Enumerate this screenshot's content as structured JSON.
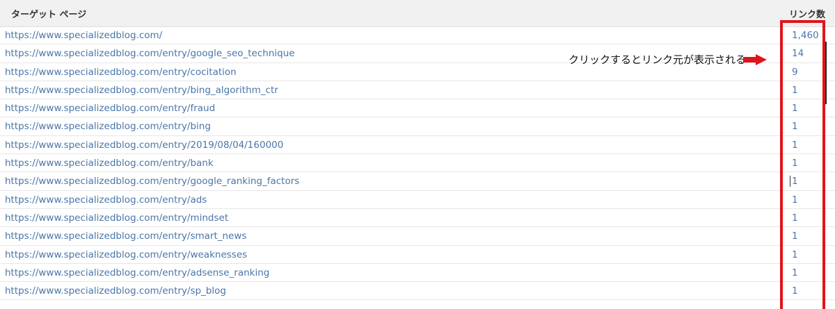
{
  "table": {
    "header": {
      "target_page": "ターゲット ページ",
      "link_count": "リンク数"
    },
    "rows": [
      {
        "url": "https://www.specializedblog.com/",
        "count": "1,460"
      },
      {
        "url": "https://www.specializedblog.com/entry/google_seo_technique",
        "count": "14"
      },
      {
        "url": "https://www.specializedblog.com/entry/cocitation",
        "count": "9"
      },
      {
        "url": "https://www.specializedblog.com/entry/bing_algorithm_ctr",
        "count": "1"
      },
      {
        "url": "https://www.specializedblog.com/entry/fraud",
        "count": "1"
      },
      {
        "url": "https://www.specializedblog.com/entry/bing",
        "count": "1"
      },
      {
        "url": "https://www.specializedblog.com/entry/2019/08/04/160000",
        "count": "1"
      },
      {
        "url": "https://www.specializedblog.com/entry/bank",
        "count": "1"
      },
      {
        "url": "https://www.specializedblog.com/entry/google_ranking_factors",
        "count": "1"
      },
      {
        "url": "https://www.specializedblog.com/entry/ads",
        "count": "1"
      },
      {
        "url": "https://www.specializedblog.com/entry/mindset",
        "count": "1"
      },
      {
        "url": "https://www.specializedblog.com/entry/smart_news",
        "count": "1"
      },
      {
        "url": "https://www.specializedblog.com/entry/weaknesses",
        "count": "1"
      },
      {
        "url": "https://www.specializedblog.com/entry/adsense_ranking",
        "count": "1"
      },
      {
        "url": "https://www.specializedblog.com/entry/sp_blog",
        "count": "1"
      }
    ]
  },
  "annotation": {
    "text": "クリックするとリンク元が表示される",
    "arrow_icon": "right-arrow-icon",
    "color": "#e0141b"
  },
  "colors": {
    "link": "#4a76a8",
    "header_bg": "#f1f1f1",
    "highlight": "#e0141b"
  }
}
